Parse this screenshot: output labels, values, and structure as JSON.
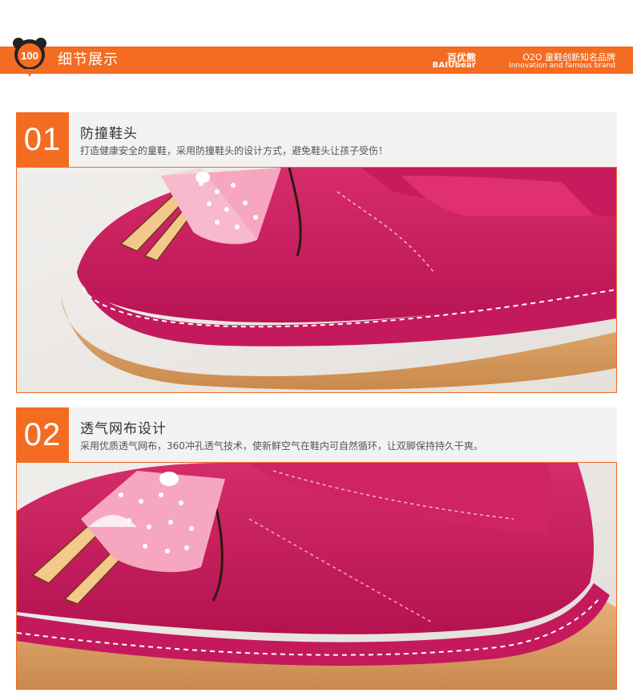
{
  "header": {
    "title": "细节展示",
    "logo_text": "100",
    "brand": {
      "name_cn": "百优熊",
      "name_en": "BAIUbear",
      "slogan_cn": "O2O 童鞋创新知名品牌",
      "slogan_en": "Innovation and famous brand"
    },
    "accent_color": "#f36c21"
  },
  "sections": [
    {
      "number": "01",
      "title": "防撞鞋头",
      "description": "打造健康安全的童鞋，采用防撞鞋头的设计方式，避免鞋头让孩子受伤！",
      "image": "shoe-toe-closeup-photo"
    },
    {
      "number": "02",
      "title": "透气网布设计",
      "description": "采用优质透气网布，360冲孔透气技术，使新鲜空气在鞋内可自然循环，让双脚保持持久干爽。",
      "image": "shoe-side-closeup-photo"
    }
  ]
}
